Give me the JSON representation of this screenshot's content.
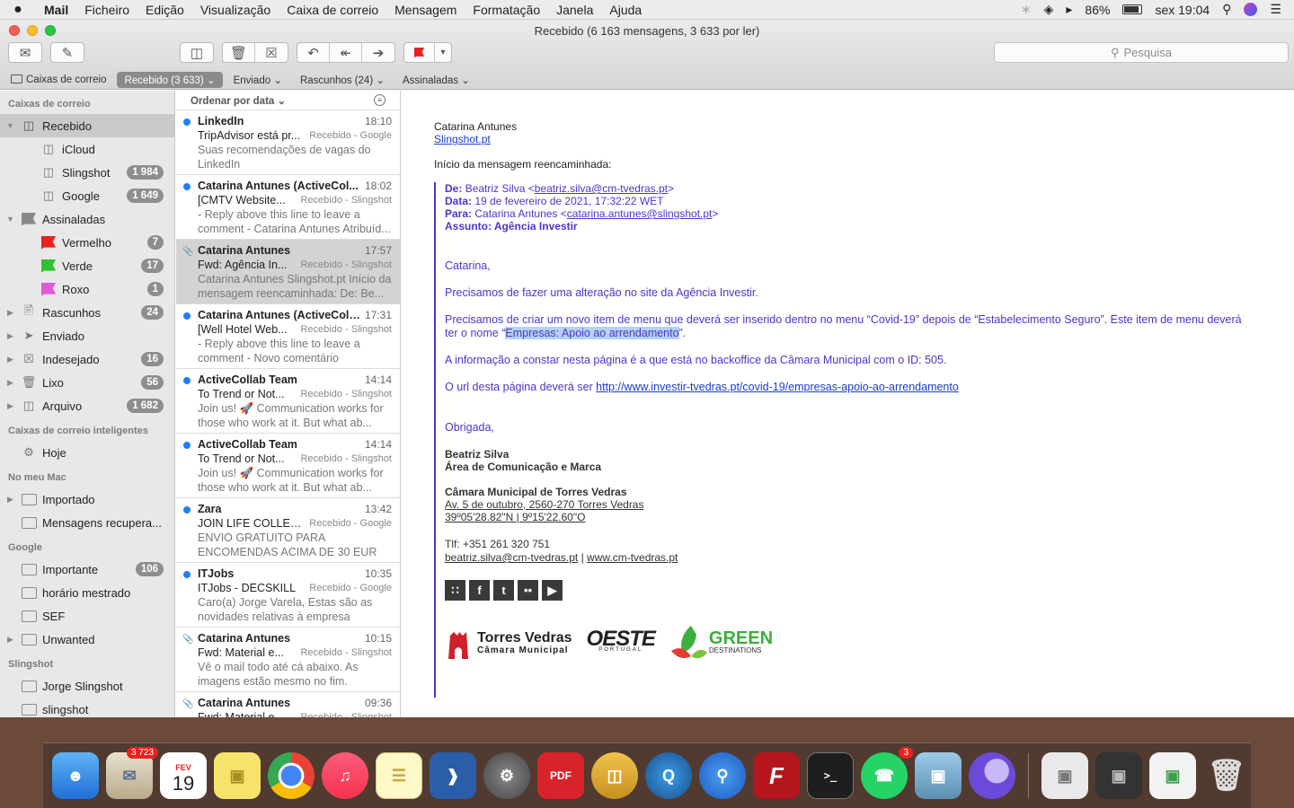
{
  "menubar": {
    "apple": "",
    "app": "Mail",
    "items": [
      "Ficheiro",
      "Edição",
      "Visualização",
      "Caixa de correio",
      "Mensagem",
      "Formatação",
      "Janela",
      "Ajuda"
    ],
    "battery": "86%",
    "clock": "sex 19:04"
  },
  "window": {
    "title": "Recebido (6 163 mensagens, 3 633 por ler)",
    "search_placeholder": "Pesquisa"
  },
  "favbar": {
    "mailboxes": "Caixas de correio",
    "inbox": "Recebido (3 633)",
    "sent": "Enviado",
    "drafts": "Rascunhos (24)",
    "flagged": "Assinaladas"
  },
  "sidebar": {
    "section_mailboxes": "Caixas de correio",
    "inbox": "Recebido",
    "icloud": "iCloud",
    "slingshot": "Slingshot",
    "slingshot_count": "1 984",
    "google": "Google",
    "google_count": "1 649",
    "flagged": "Assinaladas",
    "red": "Vermelho",
    "red_count": "7",
    "green": "Verde",
    "green_count": "17",
    "purple": "Roxo",
    "purple_count": "1",
    "drafts": "Rascunhos",
    "drafts_count": "24",
    "sent": "Enviado",
    "junk": "Indesejado",
    "junk_count": "16",
    "trash": "Lixo",
    "trash_count": "56",
    "archive": "Arquivo",
    "archive_count": "1 682",
    "section_smart": "Caixas de correio inteligentes",
    "today": "Hoje",
    "section_mac": "No meu Mac",
    "imported": "Importado",
    "recovered": "Mensagens recupera...",
    "section_google": "Google",
    "important": "Importante",
    "important_count": "106",
    "horario": "horário mestrado",
    "sef": "SEF",
    "unwanted": "Unwanted",
    "section_slingshot": "Slingshot",
    "jorge": "Jorge Slingshot",
    "slingshot_folder": "slingshot"
  },
  "list": {
    "sort": "Ordenar por data",
    "messages": [
      {
        "from": "LinkedIn",
        "time": "18:10",
        "subject": "TripAdvisor está pr...",
        "mailbox": "Recebido - Google",
        "preview": "Suas recomendações de vagas do LinkedIn",
        "unread": true
      },
      {
        "from": "Catarina Antunes (ActiveCol...",
        "time": "18:02",
        "subject": "[CMTV Website...",
        "mailbox": "Recebido - Slingshot",
        "preview": "- Reply above this line to leave a comment - Catarina Antunes Atribuíd...",
        "unread": true
      },
      {
        "from": "Catarina Antunes",
        "time": "17:57",
        "subject": "Fwd: Agência In...",
        "mailbox": "Recebido - Slingshot",
        "preview": "Catarina Antunes Slingshot.pt Início da mensagem reencaminhada: De: Be...",
        "unread": false
      },
      {
        "from": "Catarina Antunes (ActiveColl...",
        "time": "17:31",
        "subject": "[Well Hotel Web...",
        "mailbox": "Recebido - Slingshot",
        "preview": "- Reply above this line to leave a comment - Novo comentário publicad...",
        "unread": true
      },
      {
        "from": "ActiveCollab Team",
        "time": "14:14",
        "subject": "To Trend or Not...",
        "mailbox": "Recebido - Slingshot",
        "preview": "Join us! 🚀 Communication works for those who work at it.  But what ab...",
        "unread": true
      },
      {
        "from": "ActiveCollab Team",
        "time": "14:14",
        "subject": "To Trend or Not...",
        "mailbox": "Recebido - Slingshot",
        "preview": "Join us! 🚀 Communication works for those who work at it.  But what ab...",
        "unread": true
      },
      {
        "from": "Zara",
        "time": "13:42",
        "subject": "JOIN LIFE COLLEC...",
        "mailbox": "Recebido - Google",
        "preview": "ENVIO GRATUITO PARA ENCOMENDAS ACIMA DE 30 EUR NE...",
        "unread": true
      },
      {
        "from": "ITJobs",
        "time": "10:35",
        "subject": "ITJobs - DECSKILL",
        "mailbox": "Recebido - Google",
        "preview": "Caro(a) Jorge Varela, Estas são as novidades relativas à empresa DECS...",
        "unread": true
      },
      {
        "from": "Catarina Antunes",
        "time": "10:15",
        "subject": "Fwd: Material e...",
        "mailbox": "Recebido - Slingshot",
        "preview": "Vê o mail todo até cá abaixo. As imagens estão mesmo no fim. Thanks...",
        "unread": false
      },
      {
        "from": "Catarina Antunes",
        "time": "09:36",
        "subject": "Fwd: Material e...",
        "mailbox": "Recebido - Slingshot",
        "preview": "",
        "unread": false
      }
    ]
  },
  "reader": {
    "sender_name": "Catarina Antunes",
    "sender_site": "Slingshot.pt",
    "forward_intro": "Início da mensagem reencaminhada:",
    "fw_from_label": "De:",
    "fw_from_value": "Beatriz Silva <",
    "fw_from_email": "beatriz.silva@cm-tvedras.pt",
    "fw_date_label": "Data:",
    "fw_date_value": "19 de fevereiro de 2021, 17:32:22 WET",
    "fw_to_label": "Para:",
    "fw_to_value": "Catarina Antunes <",
    "fw_to_email": "catarina.antunes@slingshot.pt",
    "fw_subject_label": "Assunto:",
    "fw_subject_value": "Agência Investir",
    "greeting": "Catarina,",
    "p1": "Precisamos de fazer uma alteração no site da Agência Investir.",
    "p2a": "Precisamos de criar um novo item de menu que deverá ser inserido dentro no menu “Covid-19” depois de “Estabelecimento Seguro”. Este item de menu deverá ter o nome “",
    "p2_highlight": "Empresas: Apoio ao arrendamento",
    "p2b": "”.",
    "p3": "A informação a constar nesta página é a que está no backoffice da Câmara Municipal com o ID: 505.",
    "p4a": "O url desta página deverá ser ",
    "p4_link": "http://www.investir-tvedras.pt/covid-19/empresas-apoio-ao-arrendamento",
    "thanks": "Obrigada,",
    "sig_name": "Beatriz Silva",
    "sig_role": "Área de Comunicação e Marca",
    "sig_org": "Câmara Municipal de Torres Vedras",
    "sig_addr": "Av. 5 de outubro, 2560-270 Torres Vedras ",
    "sig_coords": "39º05'28.82\"N | 9º15'22.60\"O",
    "sig_phone": "Tlf: +351 261 320 751",
    "sig_email": "beatriz.silva@cm-tvedras.pt",
    "sig_sep": " | ",
    "sig_web": "www.cm-tvedras.pt",
    "logo1_a": "Torres Vedras",
    "logo1_b": "Câmara Municipal",
    "logo2_a": "OESTE",
    "logo2_b": "PORTUGAL",
    "logo3_a": "GREEN",
    "logo3_b": "DESTINATIONS"
  },
  "dock": {
    "mail_badge": "3 723",
    "cal_month": "FEV",
    "cal_day": "19",
    "whatsapp_badge": "3"
  },
  "colors": {
    "unread_dot": "#1e7ffb",
    "quote": "#4b36c9",
    "link": "#1a3bd1",
    "highlight": "#b5d1f5"
  }
}
